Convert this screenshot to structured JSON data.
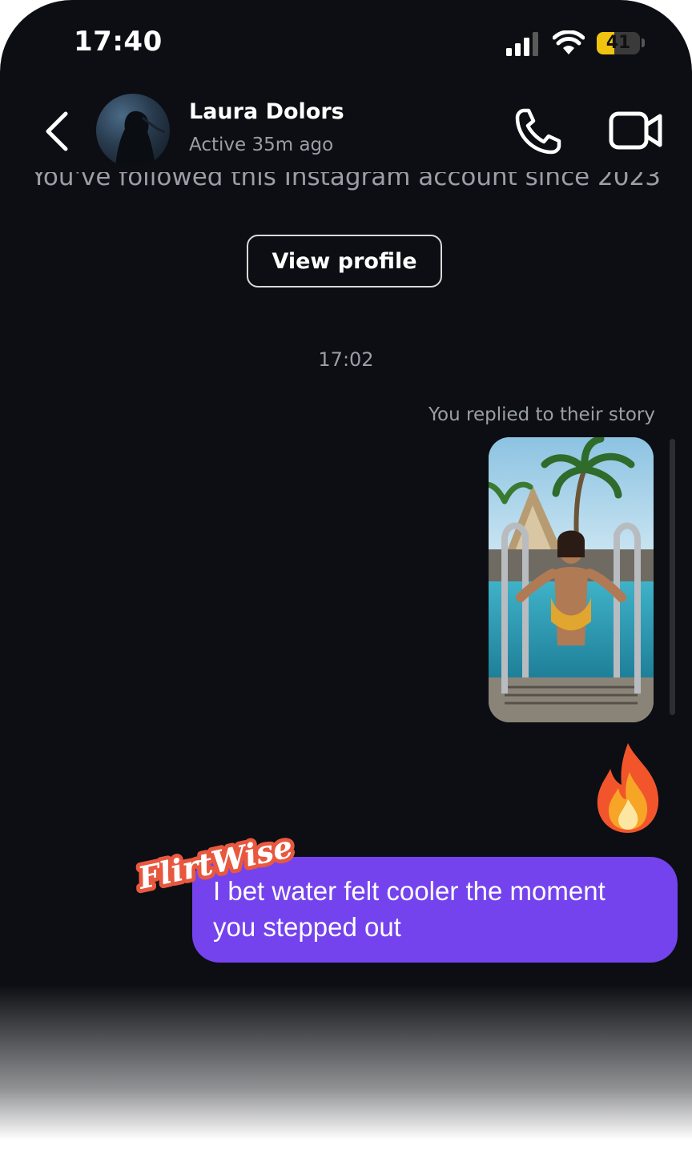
{
  "status_bar": {
    "time": "17:40",
    "battery_level": "41"
  },
  "header": {
    "name": "Laura Dolors",
    "status": "Active 35m ago",
    "icons": [
      "back-chevron-icon",
      "phone-icon",
      "video-camera-icon"
    ]
  },
  "thread": {
    "info_text": "You've followed this Instagram account since 2023",
    "view_profile_label": "View profile",
    "timestamp": "17:02",
    "reply_note": "You replied to their story",
    "reaction": "🔥",
    "message": "I bet water felt cooler the moment you stepped out"
  },
  "overlay": {
    "brand": "FlirtWise"
  },
  "colors": {
    "background": "#0c0e13",
    "bubble": "#7443ee",
    "secondary_text": "#9a9ea6",
    "brand_badge": "#e8583f",
    "battery": "#f1c40f"
  }
}
